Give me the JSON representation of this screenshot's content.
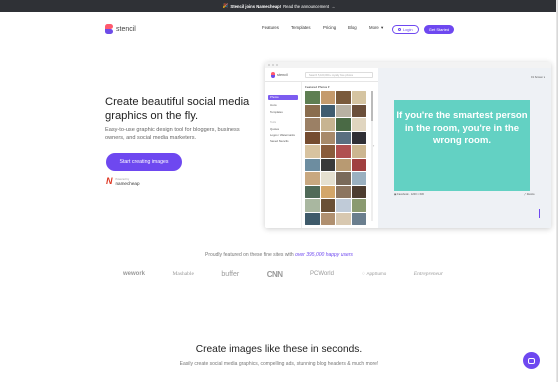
{
  "announcement": {
    "emoji": "🎉",
    "bold": "Stencil joins Namecheap!",
    "text": "Read the announcement",
    "arrow": "→"
  },
  "nav": {
    "logo_text": "stencil",
    "items": [
      "Features",
      "Templates",
      "Pricing",
      "Blog",
      "More"
    ],
    "more_caret": "▾",
    "login_label": "Login",
    "started_label": "Get Started"
  },
  "hero": {
    "title": "Create beautiful social media graphics on the fly.",
    "subtitle": "Easy-to-use graphic design tool for bloggers, business owners, and social media marketers.",
    "cta": "Start creating images",
    "partner_small": "Powered by",
    "partner_name": "namecheap",
    "partner_mark": "N"
  },
  "app_preview": {
    "logo_text": "stencil",
    "search_placeholder": "Search 5,100,000+ royalty free photos",
    "sidebar_items": [
      "Photos",
      "Icons",
      "Templates"
    ],
    "sidebar_heading": "Tools",
    "sidebar_tools": [
      "Quotes",
      "Logos / Watermarks",
      "Saved Stencils"
    ],
    "photos_label": "Featured Photos ▾",
    "canvas_header": "Fit Screen ▾",
    "canvas_quote": "If you're the smartest person in the room, you're in the wrong room.",
    "canvas_caption_left": "▣ Facebook · 1200 × 630",
    "canvas_caption_right": "⤢ Resize",
    "arrow": "‹",
    "photo_colors": [
      "#5e7e52",
      "#c49a6c",
      "#7a5a3b",
      "#d5c4a1",
      "#8a6d4e",
      "#3f5c70",
      "#b8b1a3",
      "#6b4f3a",
      "#9b8065",
      "#c7b491",
      "#4a6a45",
      "#e0d5bf",
      "#754c30",
      "#a88a6a",
      "#5a6f80",
      "#2f2f35",
      "#d8c3a0",
      "#895c3c",
      "#b05050",
      "#ccb690",
      "#6d8da0",
      "#3a3a3a",
      "#b89a72",
      "#a04040",
      "#c8a880",
      "#e5e0d0",
      "#7a6a5a",
      "#9ab0c0",
      "#506a58",
      "#d3a66a",
      "#8c7560",
      "#4d3d30",
      "#a9b7a0",
      "#6a5036",
      "#c0cbd8",
      "#8a9a70",
      "#3e5a6a",
      "#b09070",
      "#d8c8b0",
      "#6a7e8e"
    ]
  },
  "featured": {
    "prefix": "Proudly featured on these fine sites with",
    "highlight": "over 395,000 happy users"
  },
  "press": [
    "wework",
    "Mashable",
    "buffer",
    "CNN",
    "PCWorld",
    "♢ AppSumo",
    "Entrepreneur"
  ],
  "section": {
    "title": "Create images like these in seconds.",
    "subtitle": "Easily create social media graphics, compelling ads, stunning blog headers & much more!"
  },
  "colors": {
    "accent": "#6e48f0",
    "quote_bg": "#63d1c3",
    "topbar": "#2f3136"
  }
}
